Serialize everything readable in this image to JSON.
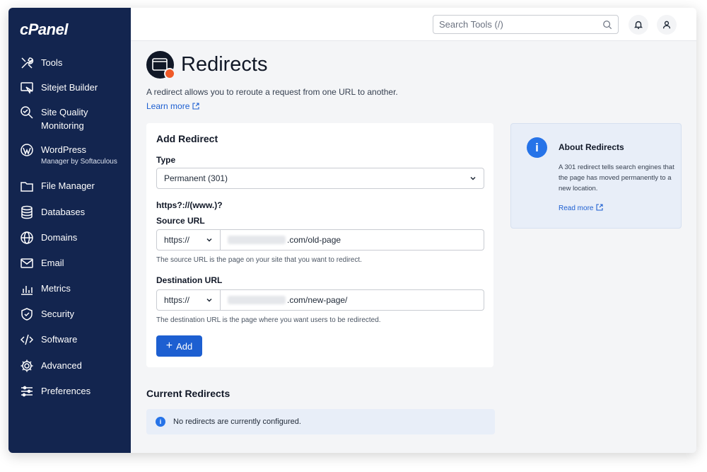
{
  "brand": {
    "logo": "cPanel"
  },
  "sidebar": {
    "items": [
      {
        "label": "Tools",
        "sub": "",
        "icon": "tools-icon"
      },
      {
        "label": "Sitejet Builder",
        "sub": "",
        "icon": "sitejet-icon"
      },
      {
        "label": "Site Quality Monitoring",
        "sub": "",
        "icon": "site-quality-icon"
      },
      {
        "label": "WordPress",
        "sub": "Manager by Softaculous",
        "icon": "wordpress-icon"
      },
      {
        "label": "File Manager",
        "sub": "",
        "icon": "folder-icon"
      },
      {
        "label": "Databases",
        "sub": "",
        "icon": "database-icon"
      },
      {
        "label": "Domains",
        "sub": "",
        "icon": "globe-icon"
      },
      {
        "label": "Email",
        "sub": "",
        "icon": "mail-icon"
      },
      {
        "label": "Metrics",
        "sub": "",
        "icon": "metrics-icon"
      },
      {
        "label": "Security",
        "sub": "",
        "icon": "shield-icon"
      },
      {
        "label": "Software",
        "sub": "",
        "icon": "software-icon"
      },
      {
        "label": "Advanced",
        "sub": "",
        "icon": "gear-icon"
      },
      {
        "label": "Preferences",
        "sub": "",
        "icon": "sliders-icon"
      }
    ]
  },
  "topbar": {
    "search_placeholder": "Search Tools (/)"
  },
  "page": {
    "title": "Redirects",
    "description": "A redirect allows you to reroute a request from one URL to another.",
    "learn_more": "Learn more"
  },
  "form": {
    "title": "Add Redirect",
    "type_label": "Type",
    "type_value": "Permanent (301)",
    "pattern_label": "https?://(www.)?",
    "source_label": "Source URL",
    "source_protocol": "https://",
    "source_value": ".com/old-page",
    "source_help": "The source URL is the page on your site that you want to redirect.",
    "dest_label": "Destination URL",
    "dest_protocol": "https://",
    "dest_value": ".com/new-page/",
    "dest_help": "The destination URL is the page where you want users to be redirected.",
    "add_label": "Add"
  },
  "aside": {
    "title": "About Redirects",
    "text": "A 301 redirect tells search engines that the page has moved permanently to a new location.",
    "link": "Read more"
  },
  "current": {
    "title": "Current Redirects",
    "empty": "No redirects are currently configured."
  },
  "colors": {
    "sidebar": "#13254f",
    "accent": "#1d5fd1",
    "info": "#2673e8",
    "badge": "#f05a28"
  }
}
